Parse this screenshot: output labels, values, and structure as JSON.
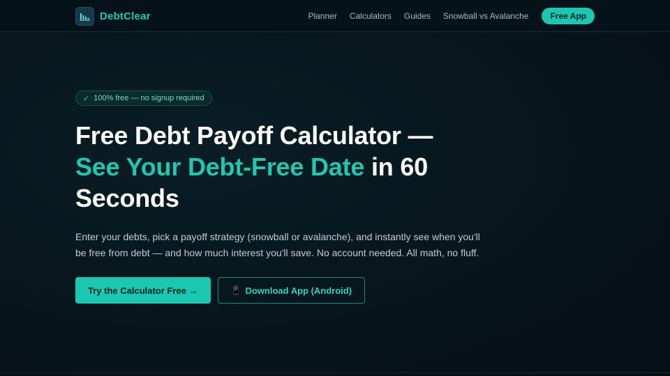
{
  "nav": {
    "brand": "DebtClear",
    "links": [
      "Planner",
      "Calculators",
      "Guides",
      "Snowball vs Avalanche"
    ],
    "cta": "Free App"
  },
  "hero": {
    "badge_icon": "check-icon",
    "badge": "100% free — no signup required",
    "title_part1": "Free Debt Payoff Calculator — ",
    "title_accent": "See Your Debt-Free Date",
    "title_part2": " in 60 Seconds",
    "lede": "Enter your debts, pick a payoff strategy (snowball or avalanche), and instantly see when you'll be free from debt — and how much interest you'll save. No account needed. All math, no fluff.",
    "primary_cta": "Try the Calculator Free →",
    "secondary_cta_icon": "phone-icon",
    "secondary_cta": "Download App (Android)"
  },
  "colors": {
    "accent": "#1cc7b1",
    "background": "#07161c"
  }
}
